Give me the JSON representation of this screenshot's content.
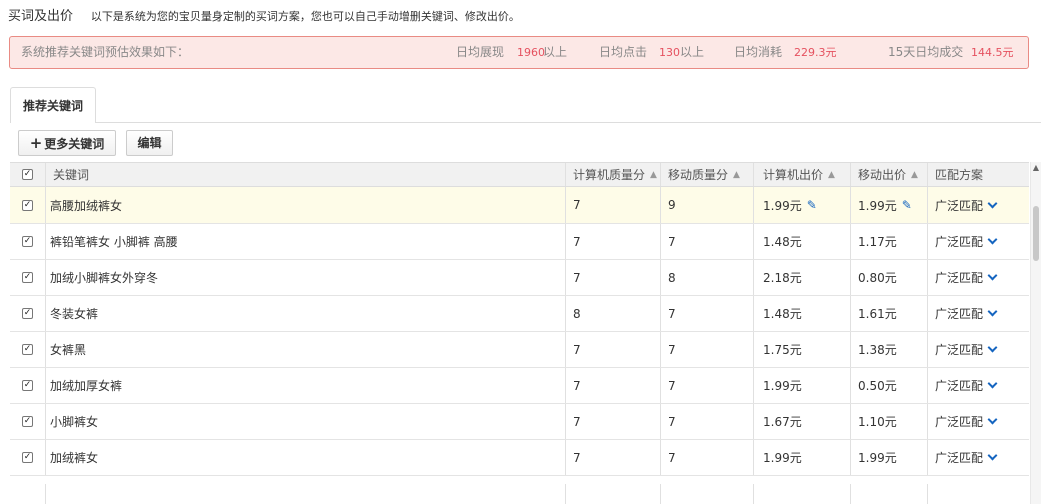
{
  "header": {
    "title": "买词及出价",
    "description": "以下是系统为您的宝贝量身定制的买词方案，您也可以自己手动增删关键词、修改出价。"
  },
  "summary": {
    "label": "系统推荐关键词预估效果如下：",
    "impressions_label": "日均展现",
    "impressions_value": "1960",
    "impressions_suffix": "以上",
    "clicks_label": "日均点击",
    "clicks_value": "130",
    "clicks_suffix": "以上",
    "cost_label": "日均消耗",
    "cost_value": "229.3元",
    "deals_label": "15天日均成交",
    "deals_value": "144.5元"
  },
  "tabs": [
    {
      "label": "推荐关键词"
    }
  ],
  "toolbar": {
    "more_keywords_label": "更多关键词",
    "edit_label": "编辑"
  },
  "table": {
    "headers": {
      "keyword": "关键词",
      "pc_quality": "计算机质量分",
      "mobile_quality": "移动质量分",
      "pc_bid": "计算机出价",
      "mobile_bid": "移动出价",
      "match": "匹配方案"
    },
    "rows": [
      {
        "keyword": "高腰加绒裤女",
        "pc_quality": "7",
        "mobile_quality": "9",
        "pc_bid": "1.99元",
        "mobile_bid": "1.99元",
        "match": "广泛匹配",
        "highlight": true
      },
      {
        "keyword": "裤铅笔裤女 小脚裤 高腰",
        "pc_quality": "7",
        "mobile_quality": "7",
        "pc_bid": "1.48元",
        "mobile_bid": "1.17元",
        "match": "广泛匹配"
      },
      {
        "keyword": "加绒小脚裤女外穿冬",
        "pc_quality": "7",
        "mobile_quality": "8",
        "pc_bid": "2.18元",
        "mobile_bid": "0.80元",
        "match": "广泛匹配"
      },
      {
        "keyword": "冬装女裤",
        "pc_quality": "8",
        "mobile_quality": "7",
        "pc_bid": "1.48元",
        "mobile_bid": "1.61元",
        "match": "广泛匹配"
      },
      {
        "keyword": "女裤黑",
        "pc_quality": "7",
        "mobile_quality": "7",
        "pc_bid": "1.75元",
        "mobile_bid": "1.38元",
        "match": "广泛匹配"
      },
      {
        "keyword": "加绒加厚女裤",
        "pc_quality": "7",
        "mobile_quality": "7",
        "pc_bid": "1.99元",
        "mobile_bid": "0.50元",
        "match": "广泛匹配"
      },
      {
        "keyword": "小脚裤女",
        "pc_quality": "7",
        "mobile_quality": "7",
        "pc_bid": "1.67元",
        "mobile_bid": "1.10元",
        "match": "广泛匹配"
      },
      {
        "keyword": "加绒裤女",
        "pc_quality": "7",
        "mobile_quality": "7",
        "pc_bid": "1.99元",
        "mobile_bid": "1.99元",
        "match": "广泛匹配"
      }
    ]
  },
  "colors": {
    "accent_blue": "#1565c0",
    "alert_value": "#e5515f",
    "alert_bg": "#fce8e6",
    "row_highlight": "#fefce8"
  }
}
